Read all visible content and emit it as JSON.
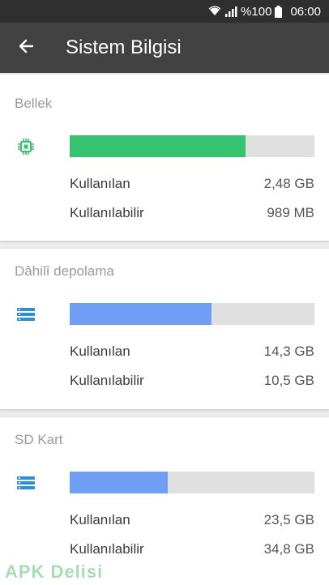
{
  "status_bar": {
    "battery_percent_text": "%100",
    "time": "06:00",
    "icons": [
      "wifi-icon",
      "signal-icon",
      "battery-icon"
    ]
  },
  "app_bar": {
    "title": "Sistem Bilgisi",
    "back_icon": "arrow-left-icon"
  },
  "colors": {
    "memory_bar": "#34c36e",
    "storage_bar": "#6f9ff5",
    "memory_icon": "#34c36e",
    "storage_icon": "#2c8fd8"
  },
  "cards": [
    {
      "title": "Bellek",
      "icon": "chip-icon",
      "used_fraction": 0.72,
      "used_label": "Kullanılan",
      "used_value": "2,48 GB",
      "available_label": "Kullanılabilir",
      "available_value": "989 MB"
    },
    {
      "title": "Dâhilî depolama",
      "icon": "storage-list-icon",
      "used_fraction": 0.58,
      "used_label": "Kullanılan",
      "used_value": "14,3 GB",
      "available_label": "Kullanılabilir",
      "available_value": "10,5 GB"
    },
    {
      "title": "SD Kart",
      "icon": "storage-list-icon",
      "used_fraction": 0.4,
      "used_label": "Kullanılan",
      "used_value": "23,5 GB",
      "available_label": "Kullanılabilir",
      "available_value": "34,8 GB"
    }
  ],
  "watermark": "APK Delisi"
}
